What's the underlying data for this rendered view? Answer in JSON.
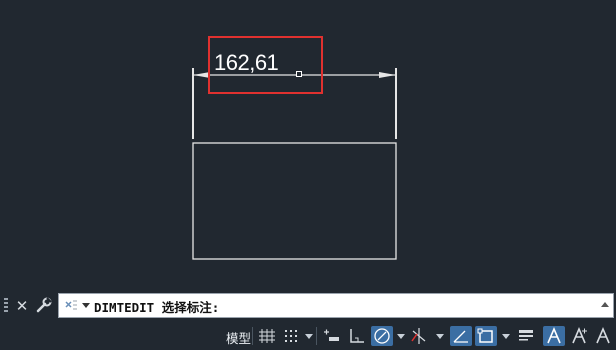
{
  "drawing": {
    "dimension_text": "162,61"
  },
  "command_line": {
    "command_text": "DIMTEDIT 选择标注:"
  },
  "status_bar": {
    "model_label": "模型"
  },
  "colors": {
    "background": "#212830",
    "highlight": "#e0312f",
    "linework": "#ffffff",
    "toggle_on": "#3b6ea3"
  }
}
